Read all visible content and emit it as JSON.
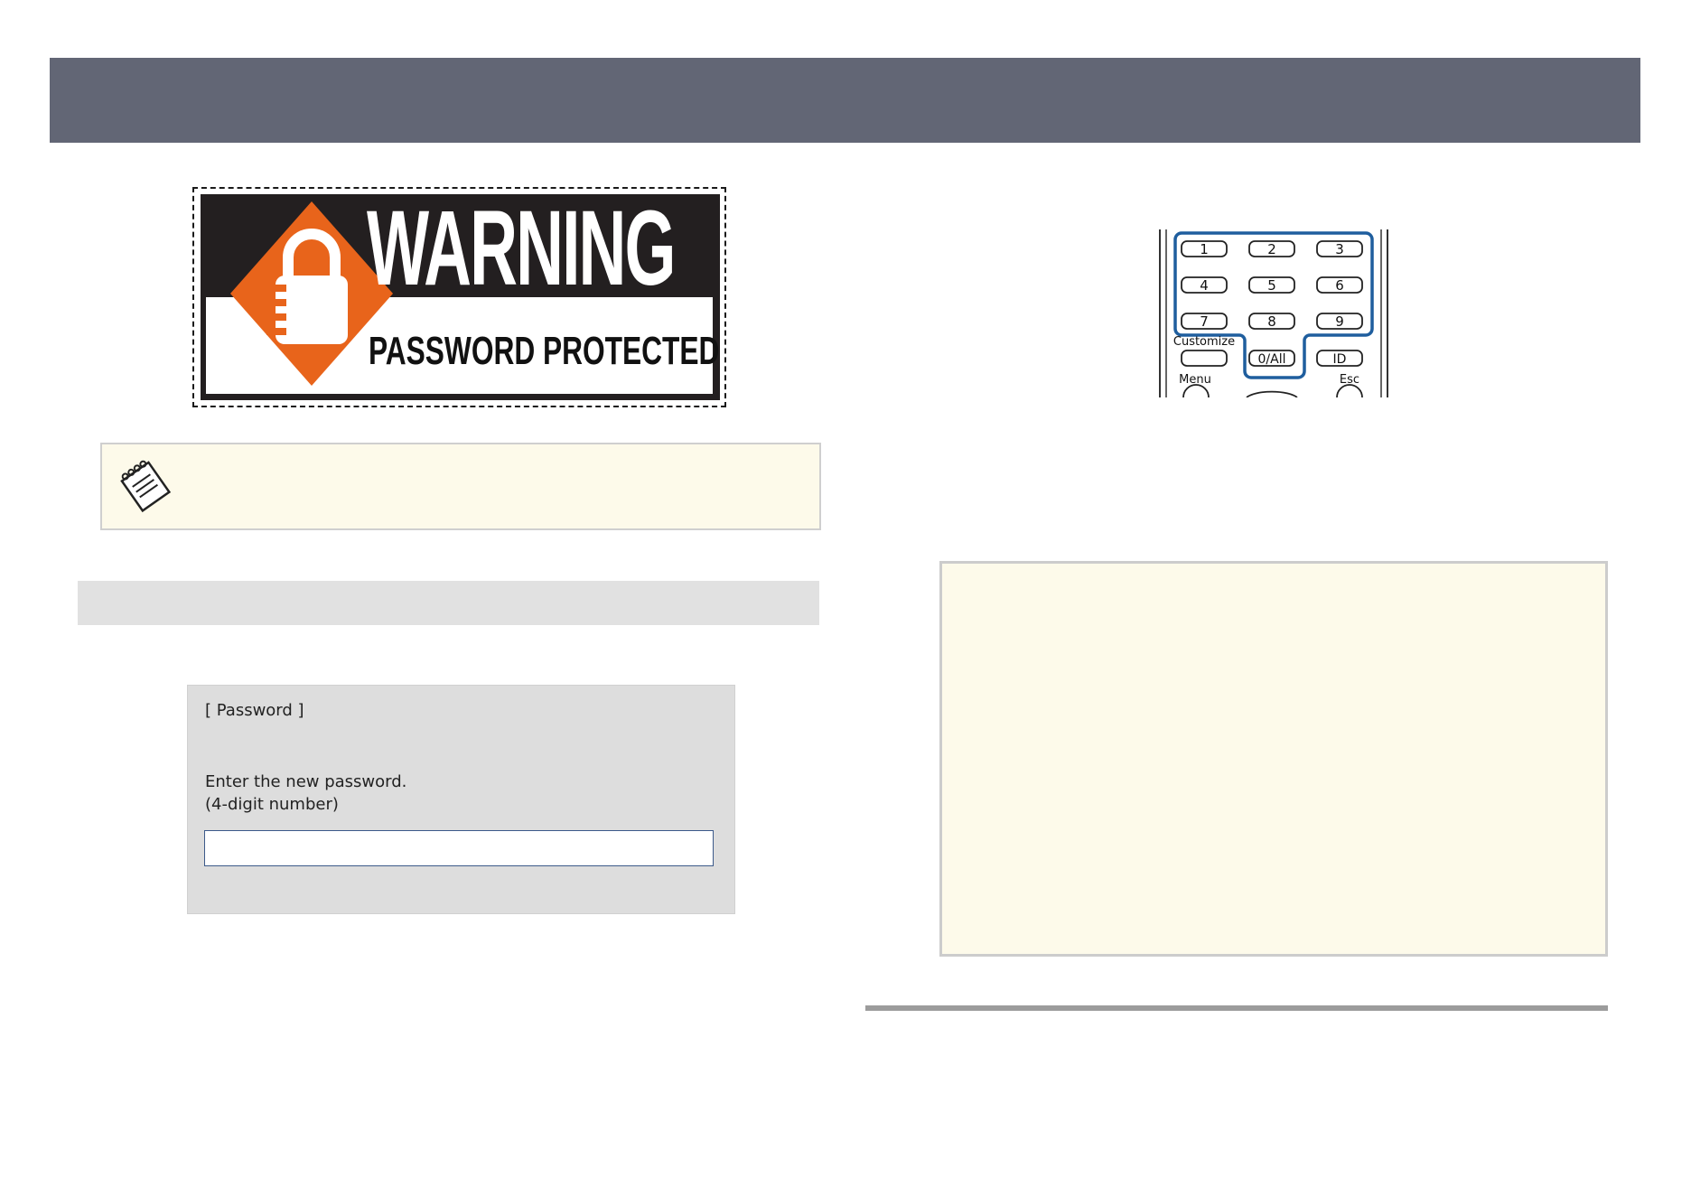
{
  "sticker": {
    "headline": "WARNING",
    "subline": "PASSWORD PROTECTED"
  },
  "password_dialog": {
    "title": "[ Password ]",
    "prompt": "Enter the new password.",
    "hint": "(4-digit number)",
    "input_value": ""
  },
  "remote": {
    "keys": [
      "1",
      "2",
      "3",
      "4",
      "5",
      "6",
      "7",
      "8",
      "9"
    ],
    "customize_label": "Customize",
    "zero_all_label": "0/All",
    "id_label": "ID",
    "menu_label": "Menu",
    "esc_label": "Esc"
  },
  "colors": {
    "banner": "#626675",
    "sticker_orange": "#e8641b",
    "note_background": "#fdfaea",
    "remote_highlight": "#1f5e9e"
  },
  "icons": {
    "note": "notepad-icon",
    "lock": "padlock-icon"
  }
}
